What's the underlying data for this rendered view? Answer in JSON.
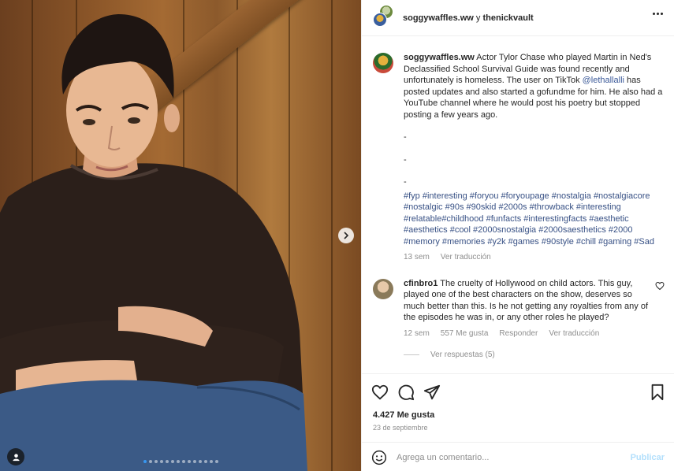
{
  "colors": {
    "link": "#385185",
    "muted": "#8e8e8e",
    "post_disabled": "#b2dffc",
    "carousel_active": "#3897f0"
  },
  "media": {
    "icons": {
      "next": "chevron-right-icon",
      "user_tag": "person-icon"
    },
    "carousel_count": 14,
    "carousel_active_index": 0
  },
  "header": {
    "user1": "soggywaffles.ww",
    "conjunction": " y ",
    "user2": "thenickvault",
    "more_icon": "more-horizontal-icon"
  },
  "caption": {
    "username": "soggywaffles.ww",
    "text_before_mention": " Actor Tylor Chase who played Martin in Ned's Declassified School Survival Guide was found recently and unfortunately is homeless. The user on TikTok ",
    "mention": "@lethallalli",
    "text_after_mention": " has posted updates and also started a gofundme for him. He also had a YouTube channel where he would post his poetry but stopped posting a few years ago.",
    "dash1": "-",
    "dash2": "-",
    "dash3": "-",
    "hashtags": "#fyp #interesting #foryou #foryoupage #nostalgia #nostalgiacore #nostalgic #90s #90skid #2000s #throwback #interesting #relatable#childhood #funfacts #interestingfacts #aesthetic #aesthetics #cool #2000snostalgia #2000saesthetics #2000 #memory #memories #y2k #games #90style #chill #gaming #Sad",
    "age": "13 sem",
    "see_translation": "Ver traducción"
  },
  "comment": {
    "username": "cfinbro1",
    "text": " The cruelty of Hollywood on child actors. This guy, played one of the best characters on the show, deserves so much better than this. Is he not getting any royalties from any of the episodes he was in, or any other roles he played?",
    "age": "12 sem",
    "likes": "557 Me gusta",
    "reply": "Responder",
    "see_translation": "Ver traducción",
    "view_replies": "Ver respuestas (5)",
    "like_icon": "heart-outline-icon"
  },
  "actions": {
    "icons": [
      "heart-icon",
      "comment-icon",
      "share-icon",
      "bookmark-icon"
    ],
    "likes": "4.427 Me gusta",
    "date": "23 de septiembre"
  },
  "add_comment": {
    "placeholder": "Agrega un comentario...",
    "post_label": "Publicar",
    "emoji_icon": "emoji-icon"
  }
}
